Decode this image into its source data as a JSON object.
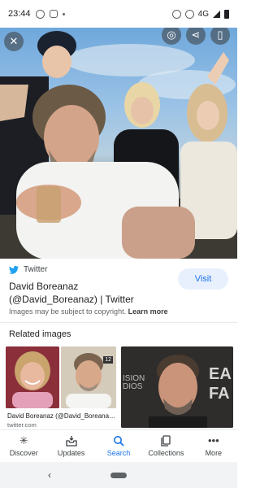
{
  "status_bar": {
    "time": "23:44",
    "network": "4G"
  },
  "hero": {
    "icons": [
      "close-icon",
      "lens-icon",
      "share-icon",
      "bookmark-icon"
    ]
  },
  "result": {
    "source": "Twitter",
    "title": "David Boreanaz (@David_Boreanaz) | Twitter",
    "visit_label": "Visit",
    "copyright_text": "Images may be subject to copyright.",
    "learn_more": "Learn more"
  },
  "related": {
    "heading": "Related images",
    "items": [
      {
        "caption": "David Boreanaz (@David_Boreanaz...",
        "source": "twitter.com",
        "badge": "12"
      },
      {
        "caption": "",
        "source": "",
        "badge": ""
      }
    ]
  },
  "bottom_nav": {
    "items": [
      {
        "label": "Discover",
        "icon": "asterisk-icon"
      },
      {
        "label": "Updates",
        "icon": "inbox-icon"
      },
      {
        "label": "Search",
        "icon": "search-icon",
        "active": true
      },
      {
        "label": "Collections",
        "icon": "collections-icon"
      },
      {
        "label": "More",
        "icon": "more-icon"
      }
    ]
  },
  "colors": {
    "accent": "#1a73e8",
    "visit_bg": "#e8f0fe",
    "twitter": "#1da1f2"
  }
}
